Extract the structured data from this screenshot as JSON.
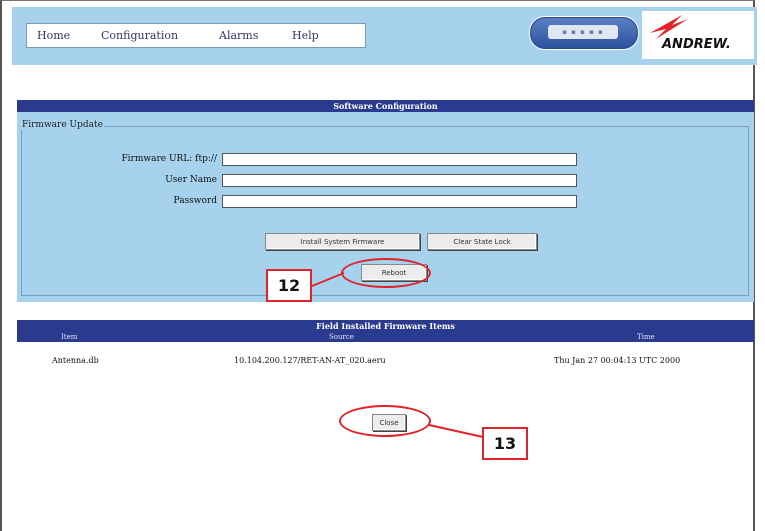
{
  "nav": {
    "items": [
      "Home",
      "Configuration",
      "Alarms",
      "Help"
    ]
  },
  "logos": {
    "brand": "ANDREW."
  },
  "software_configuration": {
    "title": "Software Configuration",
    "fieldset_legend": "Firmware Update",
    "fields": [
      {
        "label": "Firmware URL: ftp://",
        "value": ""
      },
      {
        "label": "User Name",
        "value": ""
      },
      {
        "label": "Password",
        "value": ""
      }
    ],
    "buttons": {
      "install": "Install System Firmware",
      "clear": "Clear State Lock",
      "reboot": "Reboot"
    }
  },
  "firmware_items": {
    "title": "Field Installed Firmware Items",
    "columns": [
      "Item",
      "Source",
      "Time"
    ],
    "rows": [
      {
        "item": "Antenna.db",
        "source": "10.104.200.127/RET-AN-AT_020.aeru",
        "time": "Thu Jan 27 00:04:13 UTC 2000"
      }
    ]
  },
  "close_button": "Close",
  "callouts": {
    "reboot": "12",
    "close": "13"
  },
  "colors": {
    "panel": "#a6d2ee",
    "header": "#2a3b8f",
    "callout": "#e0242a"
  }
}
